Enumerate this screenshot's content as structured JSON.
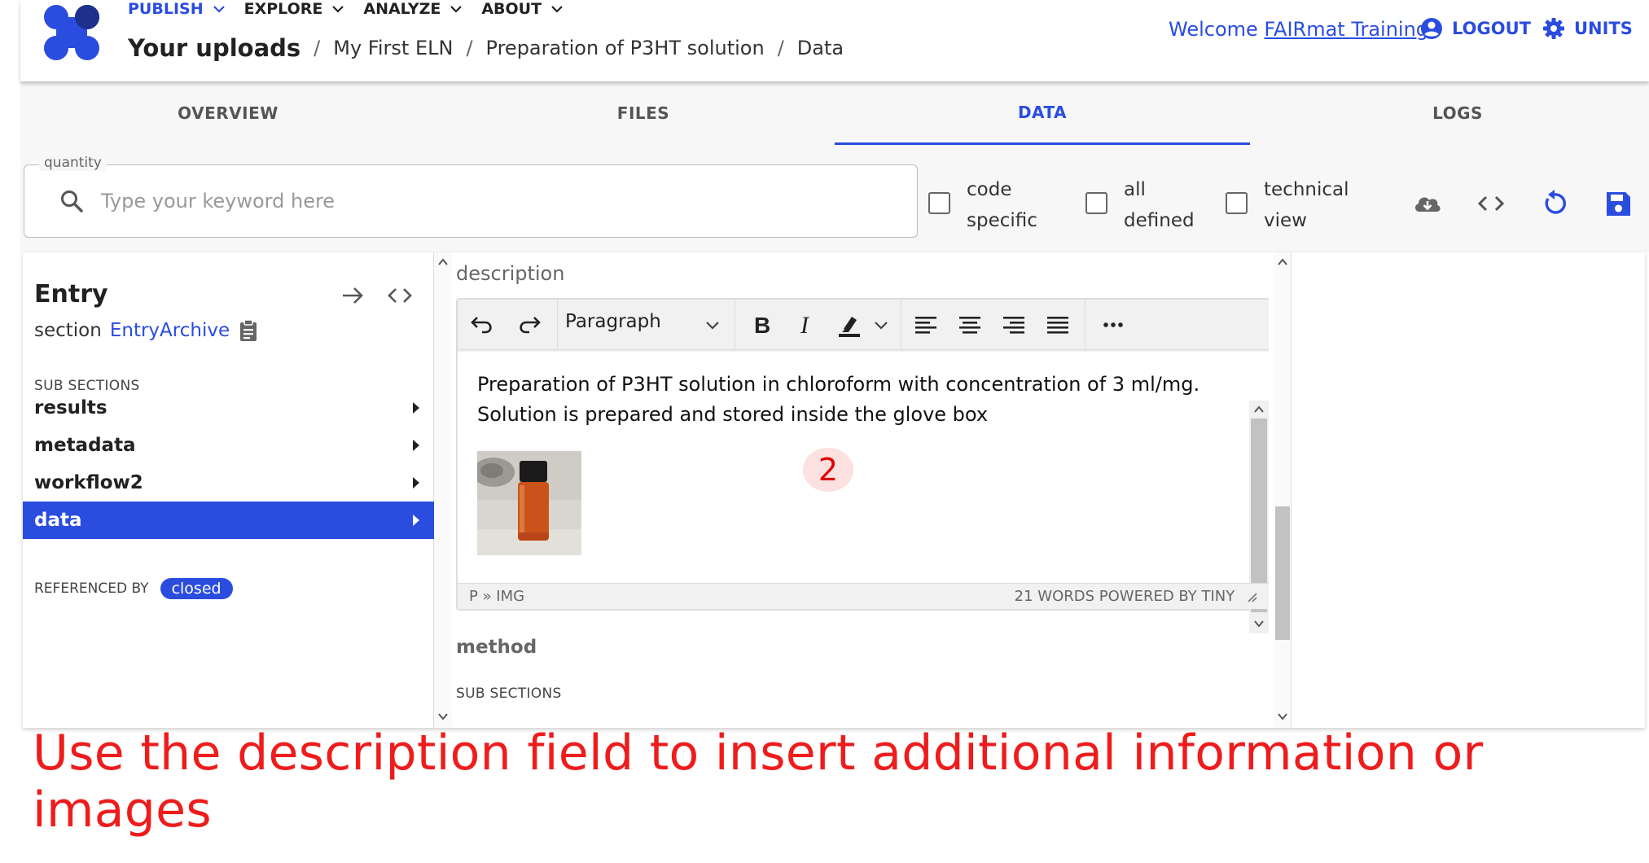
{
  "nav": {
    "menu": [
      {
        "label": "PUBLISH"
      },
      {
        "label": "EXPLORE"
      },
      {
        "label": "ANALYZE"
      },
      {
        "label": "ABOUT"
      }
    ],
    "breadcrumb": [
      "Your uploads",
      "My First ELN",
      "Preparation of P3HT solution",
      "Data"
    ],
    "welcome_prefix": "Welcome ",
    "welcome_name": "FAIRmat Training",
    "logout_label": "LOGOUT",
    "units_label": "UNITS"
  },
  "tabs": [
    "OVERVIEW",
    "FILES",
    "DATA",
    "LOGS"
  ],
  "active_tab": "DATA",
  "filter": {
    "label": "quantity",
    "placeholder": "Type your keyword here",
    "checkboxes": [
      {
        "line1": "code",
        "line2": "specific",
        "checked": false
      },
      {
        "line1": "all",
        "line2": "defined",
        "checked": false
      },
      {
        "line1": "technical",
        "line2": "view",
        "checked": false
      }
    ],
    "icons": [
      "cloud-download-icon",
      "code-icon",
      "reload-icon",
      "save-icon"
    ]
  },
  "entry": {
    "title": "Entry",
    "section_label": "section",
    "section_link": "EntryArchive",
    "sub_sections_label": "SUB SECTIONS",
    "items": [
      {
        "label": "results",
        "selected": false
      },
      {
        "label": "metadata",
        "selected": false
      },
      {
        "label": "workflow2",
        "selected": false
      },
      {
        "label": "data",
        "selected": true
      }
    ],
    "referenced_by_label": "REFERENCED BY",
    "referenced_by_chip": "closed"
  },
  "data_pane": {
    "description_label": "description",
    "block_format": "Paragraph",
    "content_line1": "Preparation of P3HT solution in chloroform with concentration of 3 ml/mg.",
    "content_line2": "Solution is prepared and stored inside the glove box",
    "marker": "2",
    "status_path": "P » IMG",
    "status_right": "21 WORDS  POWERED BY TINY",
    "method_label": "method",
    "sub_sections_label": "SUB SECTIONS"
  },
  "callout": "Use the description field to insert additional information or images",
  "colors": {
    "accent": "#2a4cdf",
    "callout": "#ee1c1c"
  }
}
